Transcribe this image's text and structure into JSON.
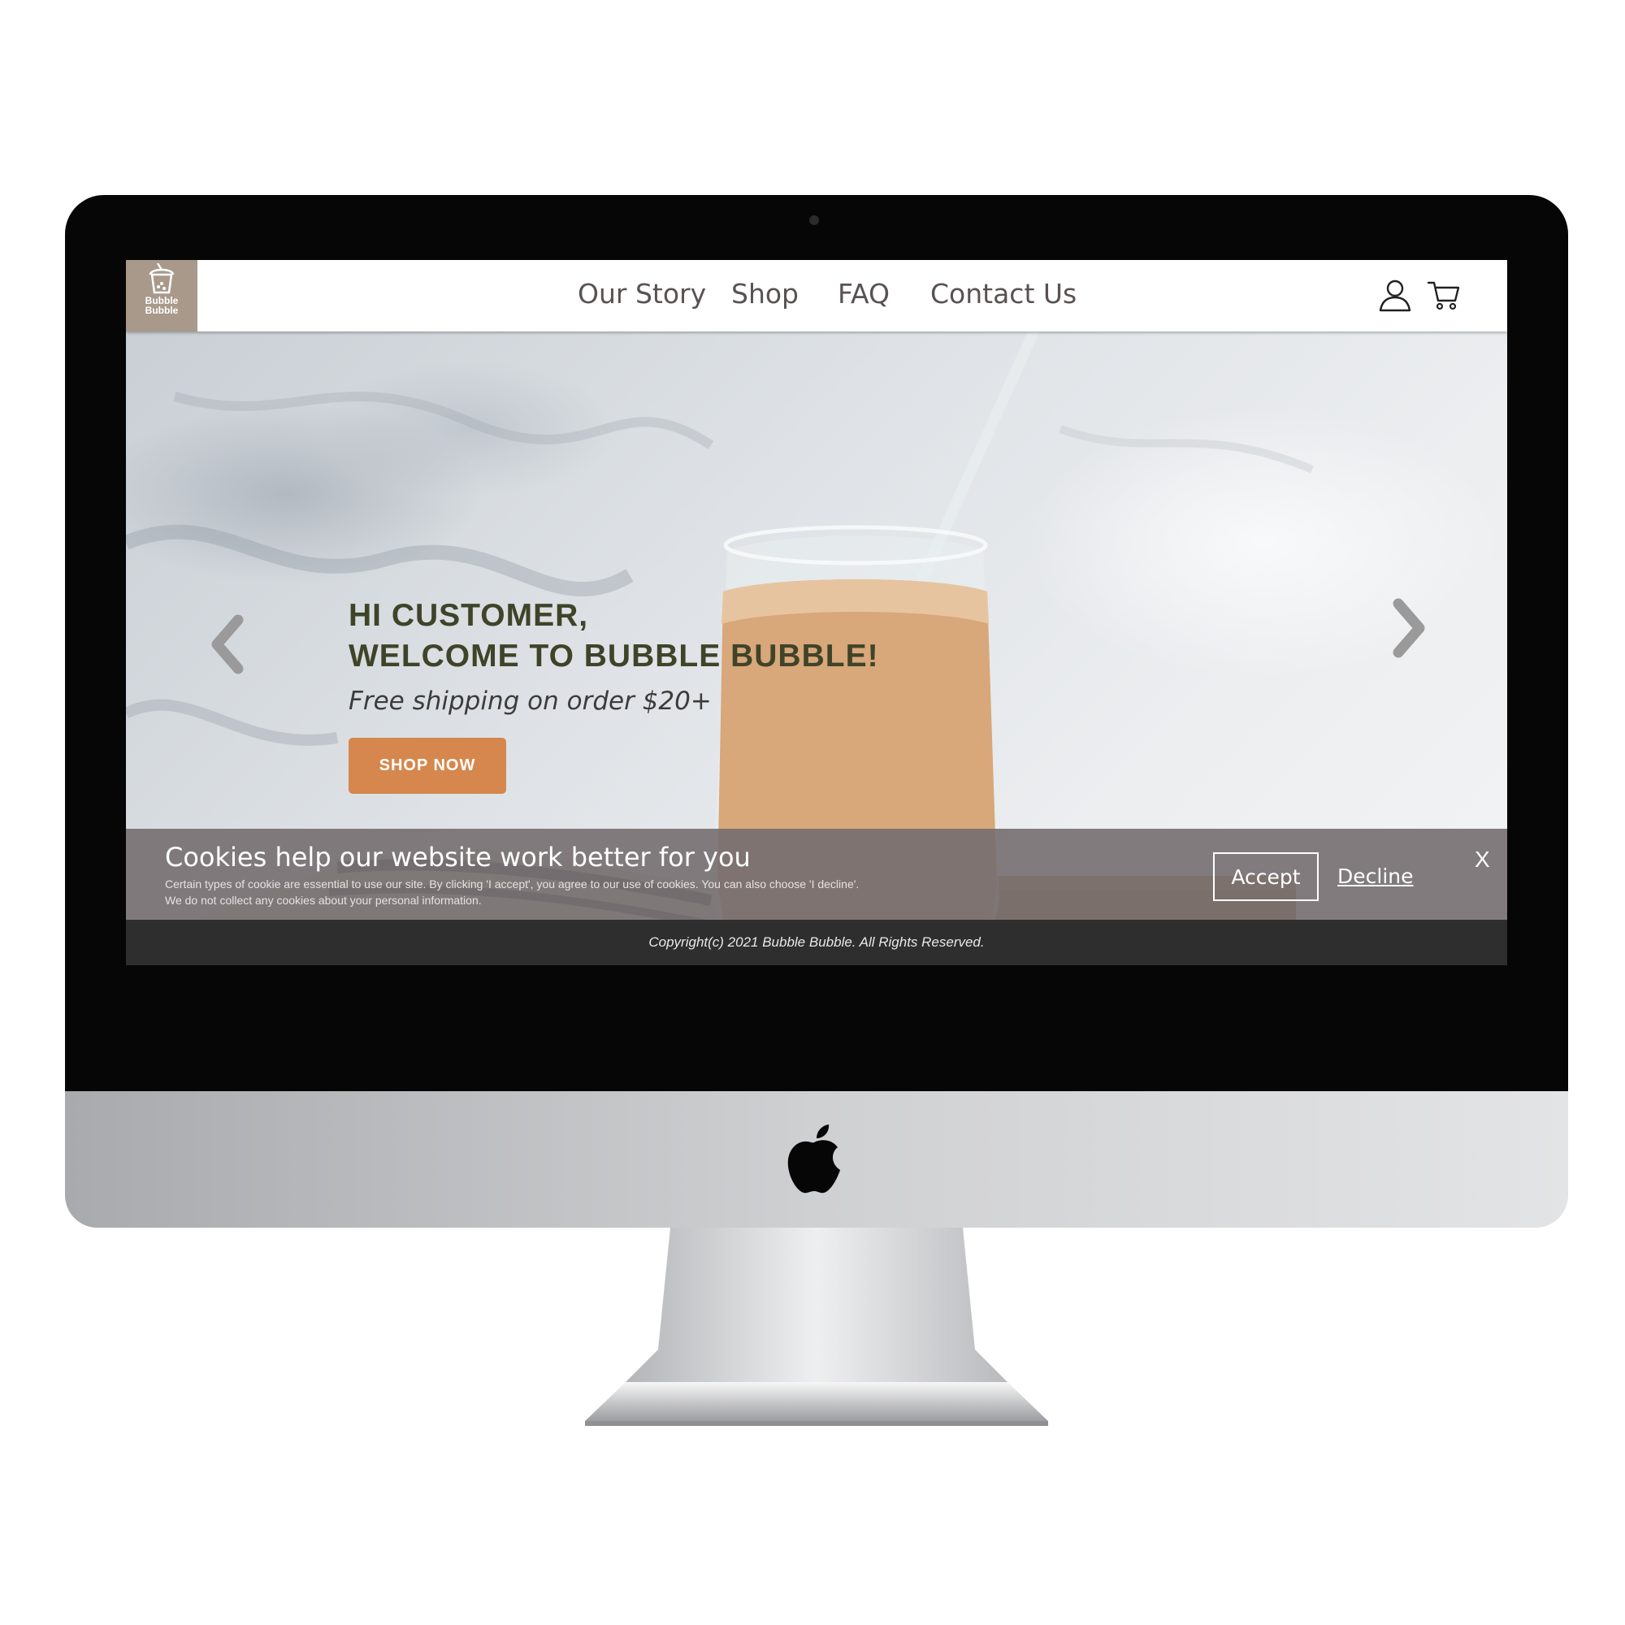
{
  "brand": {
    "logo_line1": "Bubble",
    "logo_line2": "Bubble",
    "logo_color": "#a8998b"
  },
  "nav": {
    "links": [
      "Our Story",
      "Shop",
      "FAQ",
      "Contact Us"
    ],
    "icons": [
      "user-icon",
      "cart-icon"
    ]
  },
  "hero": {
    "headline_line1": "HI CUSTOMER,",
    "headline_line2": "WELCOME TO BUBBLE BUBBLE!",
    "subtitle": "Free shipping on order $20+",
    "cta_label": "SHOP NOW",
    "cta_color": "#d6874d",
    "icons": [
      "chevron-left-icon",
      "chevron-right-icon"
    ]
  },
  "cookie_banner": {
    "title": "Cookies help our website work better for you",
    "body_line1": "Certain types of cookie are essential to use our site. By clicking 'I accept', you agree to our use of cookies. You can also choose 'I decline'.",
    "body_line2": "We do not collect any cookies about your personal information.",
    "accept_label": "Accept",
    "decline_label": "Decline",
    "close_label": "X"
  },
  "footer": {
    "copyright": "Copyright(c) 2021 Bubble Bubble. All Rights Reserved."
  }
}
